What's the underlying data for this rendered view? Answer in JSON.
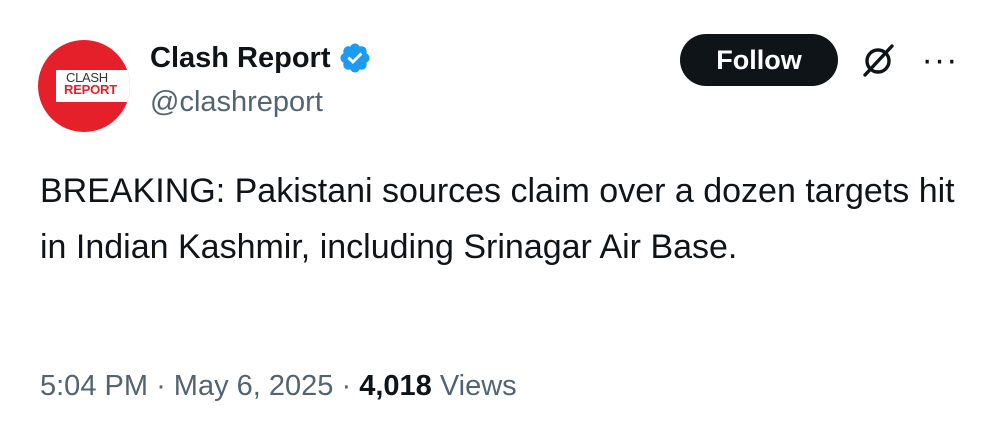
{
  "account": {
    "display_name": "Clash Report",
    "handle": "@clashreport",
    "verified": true,
    "avatar": {
      "logo_line1": "CLASH",
      "logo_line2": "REPORT"
    }
  },
  "actions": {
    "follow_label": "Follow",
    "grok_icon": "grok-icon",
    "more_label": "···"
  },
  "tweet": {
    "text": "BREAKING: Pakistani sources claim over a dozen targets hit in Indian Kashmir, including Srinagar Air Base.",
    "time": "5:04 PM",
    "separator": "·",
    "date": "May 6, 2025",
    "views_count": "4,018",
    "views_label": "Views"
  },
  "colors": {
    "brand_red": "#e5202a",
    "verified_blue": "#1d9bf0",
    "text_primary": "#0f1419",
    "text_secondary": "#536471",
    "button_bg": "#0f1419"
  }
}
